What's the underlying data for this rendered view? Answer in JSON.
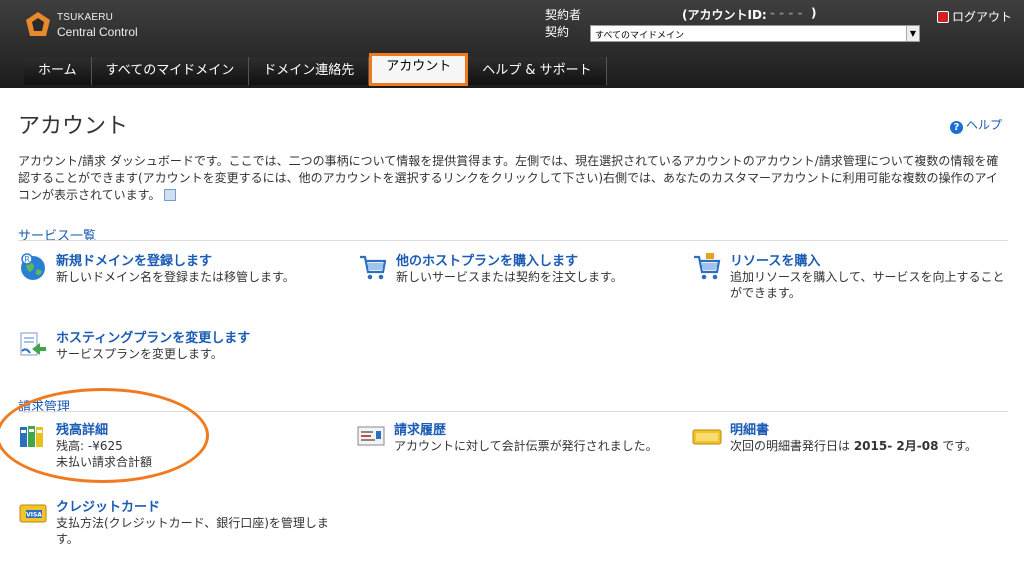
{
  "brand": {
    "line1": "TSUKAERU",
    "line2": "Central Control"
  },
  "account_bar": {
    "owner_label": "契約者",
    "account_id_label": "(アカウントID:",
    "account_id_value": "- - - -",
    "account_id_close": ")",
    "contract_label": "契約",
    "contract_selected": "すべてのマイドメイン"
  },
  "logout_label": "ログアウト",
  "nav": {
    "tabs": [
      {
        "label": "ホーム"
      },
      {
        "label": "すべてのマイドメイン"
      },
      {
        "label": "ドメイン連絡先"
      },
      {
        "label": "アカウント"
      },
      {
        "label": "ヘルプ & サポート"
      }
    ],
    "active_index": 3
  },
  "page": {
    "title": "アカウント",
    "help_label": "ヘルプ",
    "intro": "アカウント/請求 ダッシュボードです。ここでは、二つの事柄について情報を提供賞得ます。左側では、現在選択されているアカウントのアカウント/請求管理について複数の情報を確認することができます(アカウントを変更するには、他のアカウントを選択するリンクをクリックして下さい)右側では、あなたのカスタマーアカウントに利用可能な複数の操作のアイコンが表示されています。"
  },
  "services": {
    "title": "サービス一覧",
    "items": [
      {
        "title": "新規ドメインを登録します",
        "desc": "新しいドメイン名を登録または移管します。",
        "icon": "globe-icon"
      },
      {
        "title": "他のホストプランを購入します",
        "desc": "新しいサービスまたは契約を注文します。",
        "icon": "cart-icon"
      },
      {
        "title": "リソースを購入",
        "desc": "追加リソースを購入して、サービスを向上することができます。",
        "icon": "cart-plus-icon"
      },
      {
        "title": "ホスティングプランを変更します",
        "desc": "サービスプランを変更します。",
        "icon": "change-plan-icon"
      }
    ]
  },
  "billing": {
    "title": "請求管理",
    "items": [
      {
        "title": "残高詳細",
        "desc_line1": "残高: -¥625",
        "desc_line2": "未払い請求合計額",
        "icon": "binders-icon"
      },
      {
        "title": "請求履歴",
        "desc": "アカウントに対して会計伝票が発行されました。",
        "icon": "invoice-icon"
      },
      {
        "title": "明細書",
        "desc_prefix": "次回の明細書発行日は ",
        "desc_date": "2015- 2月-08",
        "desc_suffix": " です。",
        "icon": "statement-icon"
      },
      {
        "title": "クレジットカード",
        "desc": "支払方法(クレジットカード、銀行口座)を管理します。",
        "icon": "credit-card-icon"
      }
    ]
  },
  "colors": {
    "link": "#1a5bb5",
    "header_bg": "#2a2a2a",
    "highlight": "#f07a20"
  }
}
